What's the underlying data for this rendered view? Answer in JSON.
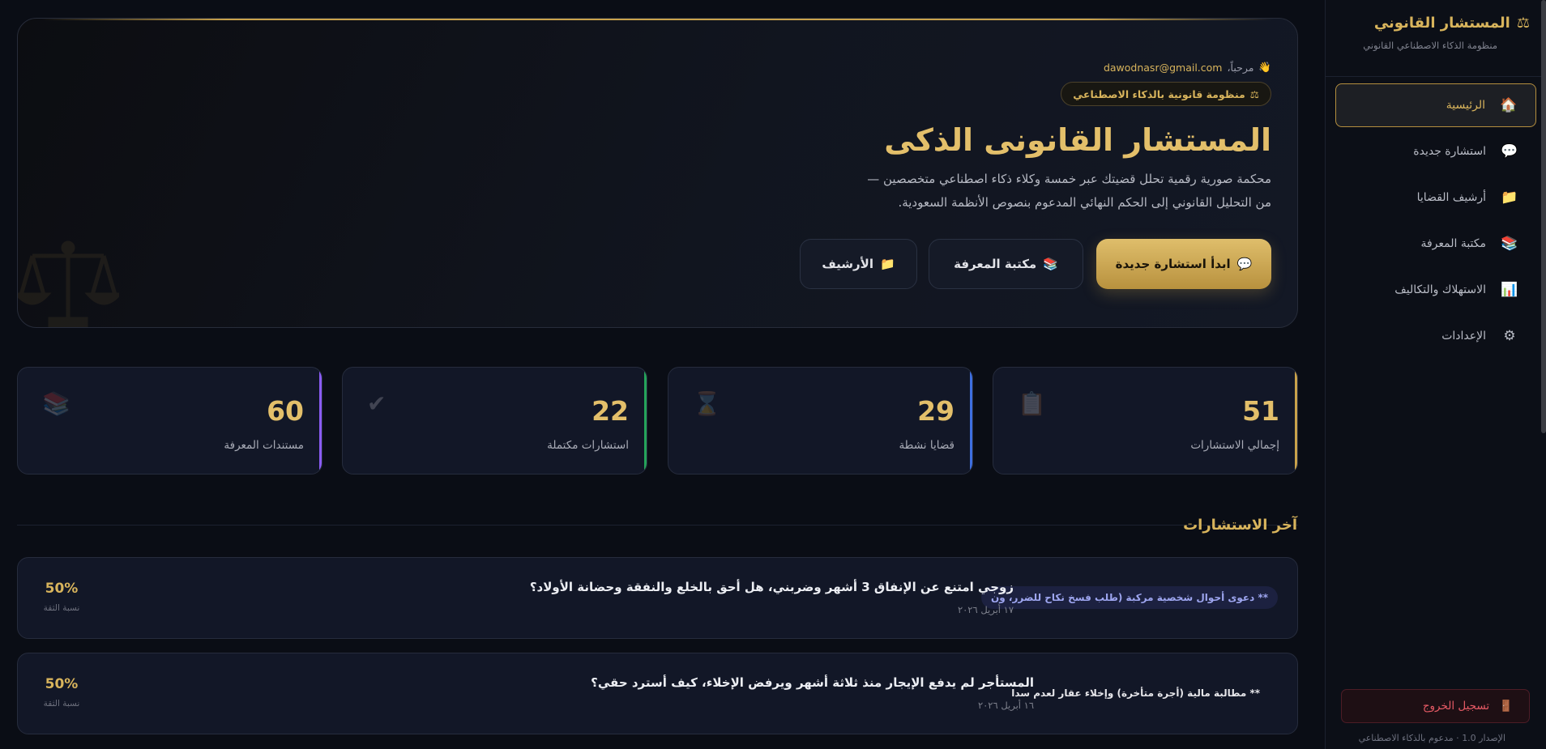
{
  "sidebar": {
    "brand_title": "المستشار القانوني",
    "brand_sub": "منظومة الذكاء الاصطناعي القانوني",
    "brand_icon": "scales-icon",
    "items": [
      {
        "label": "الرئيسية",
        "icon": "🏠",
        "active": true
      },
      {
        "label": "استشارة جديدة",
        "icon": "💬"
      },
      {
        "label": "أرشيف القضايا",
        "icon": "📁"
      },
      {
        "label": "مكتبة المعرفة",
        "icon": "📚"
      },
      {
        "label": "الاستهلاك والتكاليف",
        "icon": "📊"
      },
      {
        "label": "الإعدادات",
        "icon": "⚙"
      }
    ],
    "logout_label": "تسجيل الخروج",
    "logout_icon": "🚪",
    "version": "الإصدار 1.0 · مدعوم بالذكاء الاصطناعي"
  },
  "hero": {
    "greeting": "مرحباً،",
    "email": "dawodnasr@gmail.com",
    "wave_icon": "👋",
    "badge_icon": "⚖",
    "badge": "منظومة قانونية بالذكاء الاصطناعي",
    "title": "المستشار القانونى الذكى",
    "desc_line1": "محكمة صورية رقمية تحلل قضيتك عبر خمسة وكلاء ذكاء اصطناعي متخصصين —",
    "desc_line2": "من التحليل القانوني إلى الحكم النهائي المدعوم بنصوص الأنظمة السعودية.",
    "btn_primary": "ابدأ استشارة جديدة",
    "btn_primary_icon": "💬",
    "btn_kb": "مكتبة المعرفة",
    "btn_kb_icon": "📚",
    "btn_archive": "الأرشيف",
    "btn_archive_icon": "📁"
  },
  "stats": [
    {
      "value": "51",
      "label": "إجمالي الاستشارات",
      "icon": "📋"
    },
    {
      "value": "29",
      "label": "قضايا نشطة",
      "icon": "⌛"
    },
    {
      "value": "22",
      "label": "استشارات مكتملة",
      "icon": "✔"
    },
    {
      "value": "60",
      "label": "مستندات المعرفة",
      "icon": "📚"
    }
  ],
  "recent": {
    "title": "آخر الاستشارات",
    "items": [
      {
        "tag": "** دعوى أحوال شخصية مركبة (طلب فسخ نكاح للضرر، ون",
        "question": "زوجي امتنع عن الإنفاق 3 أشهر وضربني، هل أحق بالخلع والنفقة وحضانة الأولاد؟",
        "date": "١٧ أبريل ٢٠٢٦",
        "confidence": "50%",
        "confidence_label": "نسبة الثقة"
      },
      {
        "tag": "** مطالبة مالية (أجرة متأخرة) وإخلاء عقار لعدم سدا",
        "question": "المستأجر لم يدفع الإيجار منذ ثلاثة أشهر ويرفض الإخلاء، كيف أسترد حقي؟",
        "date": "١٦ أبريل ٢٠٢٦",
        "confidence": "50%",
        "confidence_label": "نسبة الثقة"
      }
    ]
  }
}
